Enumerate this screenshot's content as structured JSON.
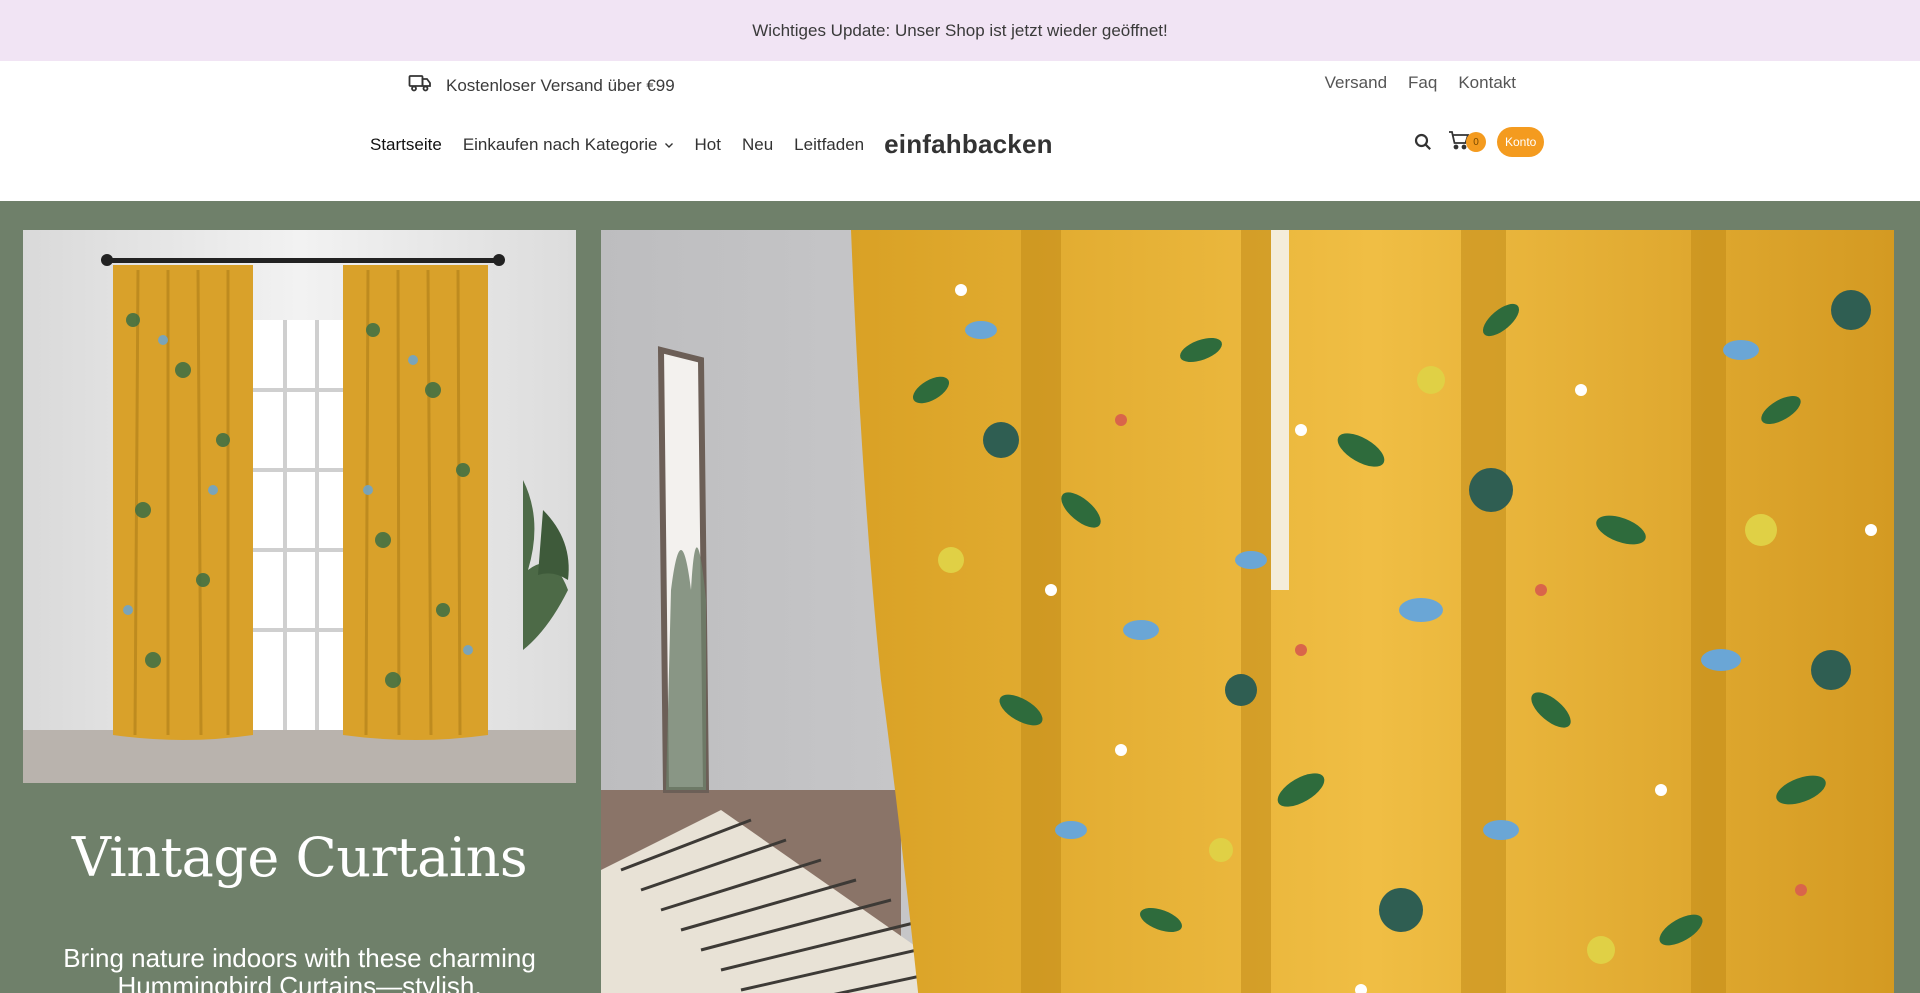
{
  "announcement": "Wichtiges Update: Unser Shop ist jetzt wieder geöffnet!",
  "topbar": {
    "shipping_text": "Kostenloser Versand über €99",
    "links": [
      "Versand",
      "Faq",
      "Kontakt"
    ]
  },
  "nav": {
    "items": [
      "Startseite",
      "Einkaufen nach Kategorie",
      "Hot",
      "Neu",
      "Leitfaden"
    ],
    "logo": "einfahbacken",
    "cart_count": "0",
    "account_label": "Konto"
  },
  "hero": {
    "title": "Vintage Curtains",
    "text": "Bring nature indoors with these charming Hummingbird Curtains—stylish,",
    "background_color": "#6f806a",
    "accent_color": "#f49b1f"
  },
  "icons": [
    "truck-icon",
    "chevron-down-icon",
    "search-icon",
    "cart-icon"
  ]
}
